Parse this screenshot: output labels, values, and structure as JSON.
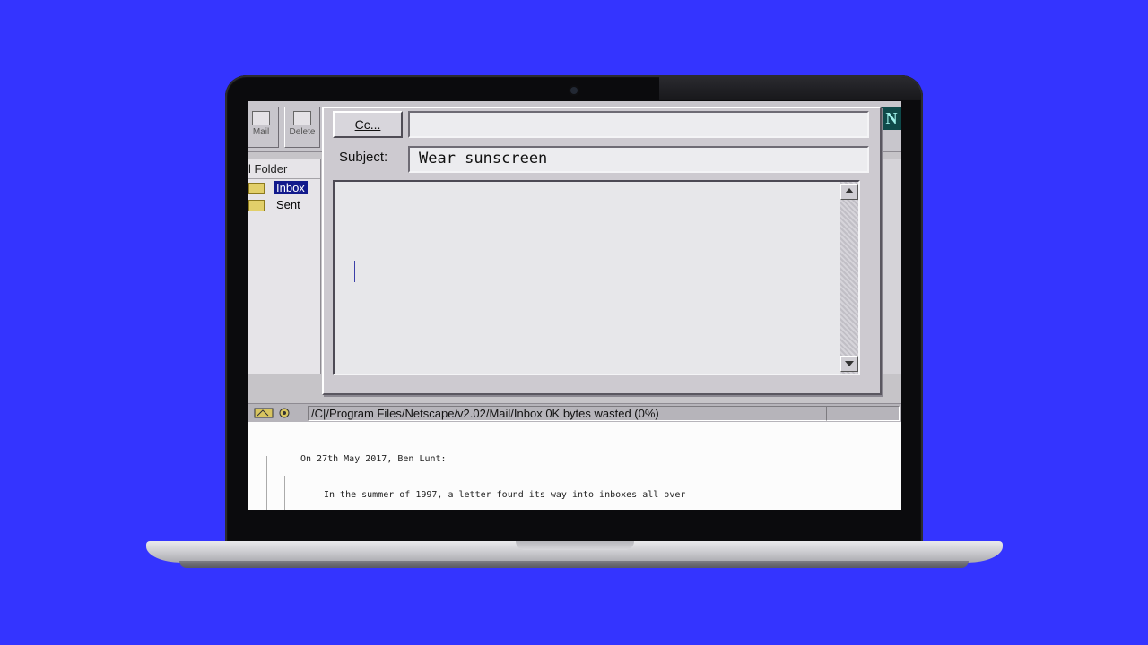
{
  "toolbar": {
    "get_mail_label": "Mail",
    "delete_label": "Delete",
    "brand_letter": "N"
  },
  "folders": {
    "header": "l Folder",
    "items": [
      {
        "label": "Inbox",
        "selected": true
      },
      {
        "label": "Sent",
        "selected": false
      }
    ]
  },
  "compose": {
    "cc_label": "Cc...",
    "cc_value": "",
    "subject_label": "Subject:",
    "subject_value": "Wear sunscreen",
    "body_value": ""
  },
  "status": {
    "path_text": "/C|/Program Files/Netscape/v2.02/Mail/Inbox 0K bytes wasted (0%)"
  },
  "message": {
    "attribution": "On 27th May 2017, Ben Lunt:",
    "quote_line": "In the summer of 1997, a letter found its way into inboxes all over"
  },
  "colors": {
    "background": "#3434ff",
    "selection": "#121a8c"
  }
}
